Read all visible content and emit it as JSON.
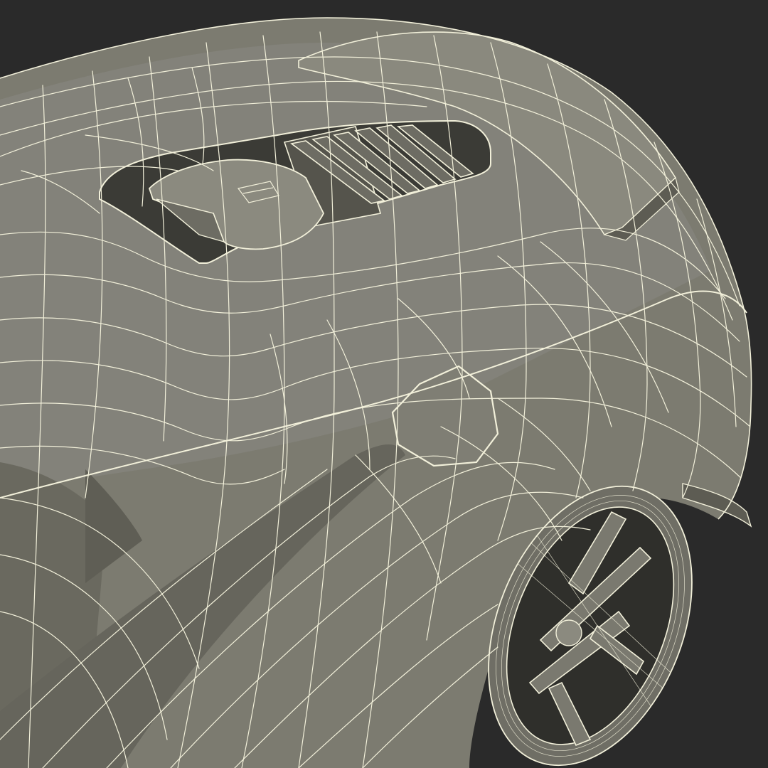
{
  "scene": {
    "subject": "car-rear-wireframe",
    "colors": {
      "background": "#2a2a2a",
      "body_shade": "#7c7b70",
      "body_light": "#8d8c80",
      "body_dark": "#5d5c53",
      "cavity": "#3b3b36",
      "wire": "#f2f0da"
    }
  }
}
